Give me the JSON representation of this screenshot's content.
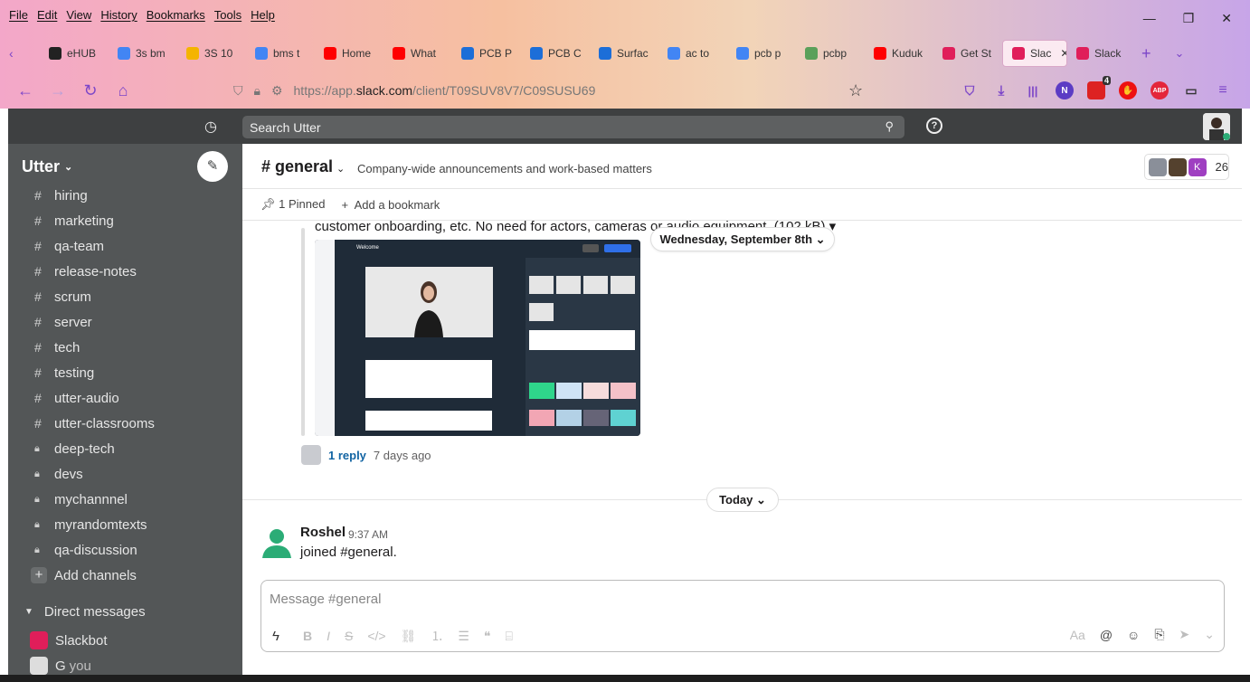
{
  "browser": {
    "menu": [
      "File",
      "Edit",
      "View",
      "History",
      "Bookmarks",
      "Tools",
      "Help"
    ],
    "window_controls": [
      "—",
      "❐",
      "✕"
    ],
    "tabs": [
      {
        "label": "eHUB",
        "color": "#222222"
      },
      {
        "label": "3s bm",
        "color": "#4285f4"
      },
      {
        "label": "3S 10",
        "color": "#f4b400"
      },
      {
        "label": "bms t",
        "color": "#4285f4"
      },
      {
        "label": "Home",
        "color": "#ff0000"
      },
      {
        "label": "What",
        "color": "#ff0000"
      },
      {
        "label": "PCB P",
        "color": "#1c6ed8"
      },
      {
        "label": "PCB C",
        "color": "#1c6ed8"
      },
      {
        "label": "Surfac",
        "color": "#1c6ed8"
      },
      {
        "label": "ac to",
        "color": "#4285f4"
      },
      {
        "label": "pcb p",
        "color": "#4285f4"
      },
      {
        "label": "pcbp",
        "color": "#5aa05a"
      },
      {
        "label": "Kuduk",
        "color": "#ff0000"
      },
      {
        "label": "Get St",
        "color": "#e01e5a"
      },
      {
        "label": "Slac",
        "color": "#e01e5a",
        "active": true
      },
      {
        "label": "Slack",
        "color": "#e01e5a"
      }
    ],
    "url_prefix": "https://app.",
    "url_host": "slack.com",
    "url_path": "/client/T09SUV8V7/C09SUSU69",
    "badge_count": "4"
  },
  "slack": {
    "search_placeholder": "Search Utter",
    "workspace": "Utter",
    "channels": [
      {
        "label": "hiring",
        "type": "public"
      },
      {
        "label": "marketing",
        "type": "public"
      },
      {
        "label": "qa-team",
        "type": "public"
      },
      {
        "label": "release-notes",
        "type": "public"
      },
      {
        "label": "scrum",
        "type": "public"
      },
      {
        "label": "server",
        "type": "public"
      },
      {
        "label": "tech",
        "type": "public"
      },
      {
        "label": "testing",
        "type": "public"
      },
      {
        "label": "utter-audio",
        "type": "public"
      },
      {
        "label": "utter-classrooms",
        "type": "public"
      },
      {
        "label": "deep-tech",
        "type": "private"
      },
      {
        "label": "devs",
        "type": "private"
      },
      {
        "label": "mychannnel",
        "type": "private"
      },
      {
        "label": "myrandomtexts",
        "type": "private"
      },
      {
        "label": "qa-discussion",
        "type": "private"
      }
    ],
    "add_channels": "Add channels",
    "dm_header": "Direct messages",
    "dms": [
      {
        "label": "Slackbot",
        "you": ""
      },
      {
        "label": "G",
        "you": "you"
      }
    ],
    "channel": {
      "name": "general",
      "topic": "Company-wide announcements and work-based matters",
      "member_count": "26",
      "pinned": "1 Pinned",
      "add_bookmark": "Add a bookmark"
    },
    "messages": {
      "partial_text": "customer onboarding, etc. No need for actors, cameras or audio equipment. (102 kB) ▾",
      "date_divider": "Wednesday, September 8th",
      "replies_link": "1 reply",
      "replies_ago": "7 days ago",
      "today_divider": "Today",
      "last": {
        "author": "Roshel",
        "time": "9:37 AM",
        "text": "joined #general."
      }
    },
    "attachment": {
      "title": "Welcome",
      "cancel": "Cancel",
      "create": "Create video",
      "script_label": "Video script",
      "script_text": "Welcome to CREATE",
      "desc_label": "Video description (optional)",
      "desc_placeholder": "Describe your video",
      "quality_label": "Use High Quality voice (audio preview unavailable)",
      "actor_label": "Select actor and alignment",
      "align": [
        "Left",
        "Center",
        "Right"
      ],
      "bg_label": "Select background",
      "bg_tabs": [
        "Solid",
        "Image",
        "Custom"
      ],
      "swatches": [
        "#2fd58b",
        "#cfe3f5",
        "#f6dcdc",
        "#f4c1c8",
        "#f2a6b4",
        "#b3d1e6",
        "#666477",
        "#5fd2d2"
      ]
    },
    "composer": {
      "placeholder": "Message #general"
    }
  }
}
